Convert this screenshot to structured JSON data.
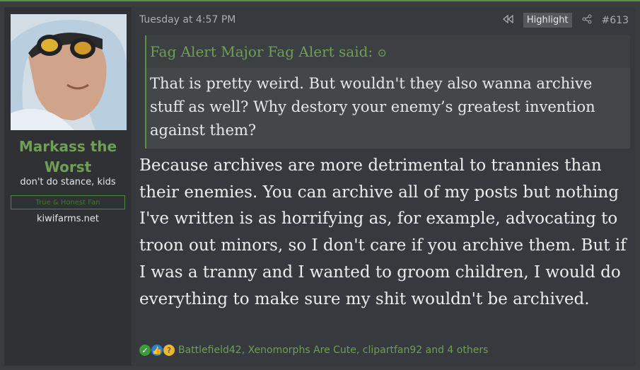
{
  "user": {
    "name": "Markass the Worst",
    "title": "don't do stance, kids",
    "banner": "True & Honest Fan",
    "extra": "kiwifarms.net"
  },
  "post": {
    "date": "Tuesday at 4:57 PM",
    "highlight_label": "Highlight",
    "number": "#613",
    "quote": {
      "author_line": "Fag Alert Major Fag Alert said:",
      "text": "That is pretty weird. But wouldn't they also wanna archive stuff as well? Why destory your enemy’s greatest invention against them?"
    },
    "body": "Because archives are more detrimental to trannies than their enemies. You can archive all of my posts but nothing I've written is as horrifying as, for example, advocating to troon out minors, so I don't care if you archive them. But if I was a tranny and I wanted to groom children, I would do everything to make sure my shit wouldn't be archived.",
    "reactions": {
      "icons": [
        "check-reaction-icon",
        "thumbs-up-reaction-icon",
        "thinking-reaction-icon"
      ],
      "text": "Battlefield42, Xenomorphs Are Cute, clipartfan92 and 4 others"
    }
  },
  "colors": {
    "accent": "#6e9f55",
    "background": "#36393d"
  }
}
